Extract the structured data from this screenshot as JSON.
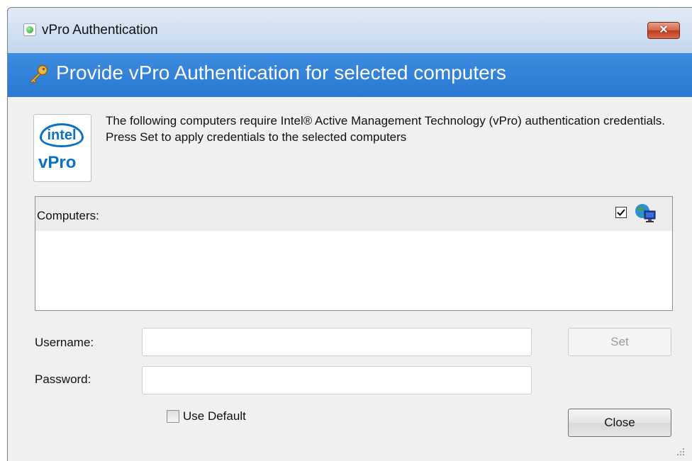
{
  "window": {
    "title": "vPro Authentication",
    "close_glyph": "✕",
    "title_icon": "green-status-icon"
  },
  "banner": {
    "icon": "key-icon",
    "title": "Provide vPro Authentication for selected computers"
  },
  "logo": {
    "brand": "intel",
    "product": "vPro"
  },
  "description": "The following computers require Intel® Active Management Technology (vPro) authentication credentials.  Press Set to apply credentials to the selected computers",
  "computers_list": {
    "header": "Computers:",
    "header_icons": [
      "checkbox-icon",
      "globe-computer-icon"
    ],
    "items": []
  },
  "form": {
    "username_label": "Username:",
    "username_value": "",
    "password_label": "Password:",
    "password_value": "",
    "use_default_label": "Use Default",
    "use_default_checked": false
  },
  "buttons": {
    "set_label": "Set",
    "set_enabled": false,
    "close_label": "Close"
  },
  "colors": {
    "banner": "#2a78d2",
    "content_bg": "#f0f0f0",
    "close_red": "#c2391b"
  }
}
